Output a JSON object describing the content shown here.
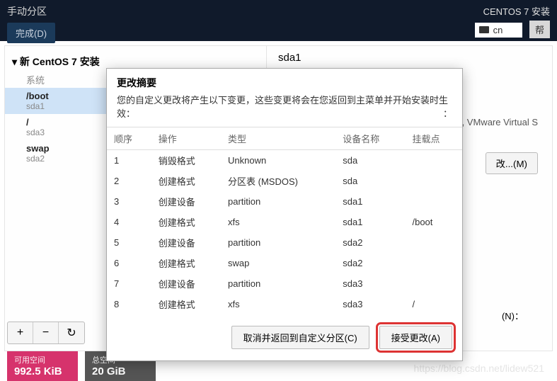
{
  "header": {
    "left_title": "手动分区",
    "done_btn": "完成(D)",
    "right_title": "CENTOS 7 安装",
    "lang": "cn",
    "help_btn": "帮"
  },
  "sidebar": {
    "expand_label": "▾ 新 CentOS 7 安装",
    "system_label": "系统",
    "partitions": [
      {
        "name": "/boot",
        "dev": "sda1",
        "selected": true
      },
      {
        "name": "/",
        "dev": "sda3",
        "selected": false
      },
      {
        "name": "swap",
        "dev": "sda2",
        "selected": false
      }
    ]
  },
  "right": {
    "title": "sda1",
    "vm_text": "are, VMware Virtual S",
    "modify_btn": "改...(M)",
    "n_label": "(N)："
  },
  "toolbar": {
    "add": "+",
    "remove": "−",
    "reload": "↻"
  },
  "footer": {
    "avail_label": "可用空间",
    "avail_value": "992.5 KiB",
    "total_label": "总空间",
    "total_value": "20 GiB"
  },
  "watermark": "https://blog.csdn.net/lidew521",
  "dialog": {
    "title": "更改摘要",
    "desc": "您的自定义更改将产生以下变更，这些变更将会在您返回到主菜单并开始安装时生效：",
    "colon": "：",
    "headers": {
      "order": "顺序",
      "operation": "操作",
      "type": "类型",
      "device": "设备名称",
      "mount": "挂载点"
    },
    "rows": [
      {
        "order": "1",
        "op": "销毁格式",
        "op_class": "destroy",
        "type": "Unknown",
        "device": "sda",
        "mount": ""
      },
      {
        "order": "2",
        "op": "创建格式",
        "op_class": "create",
        "type": "分区表 (MSDOS)",
        "device": "sda",
        "mount": ""
      },
      {
        "order": "3",
        "op": "创建设备",
        "op_class": "create",
        "type": "partition",
        "device": "sda1",
        "mount": ""
      },
      {
        "order": "4",
        "op": "创建格式",
        "op_class": "create",
        "type": "xfs",
        "device": "sda1",
        "mount": "/boot"
      },
      {
        "order": "5",
        "op": "创建设备",
        "op_class": "create",
        "type": "partition",
        "device": "sda2",
        "mount": ""
      },
      {
        "order": "6",
        "op": "创建格式",
        "op_class": "create",
        "type": "swap",
        "device": "sda2",
        "mount": ""
      },
      {
        "order": "7",
        "op": "创建设备",
        "op_class": "create",
        "type": "partition",
        "device": "sda3",
        "mount": ""
      },
      {
        "order": "8",
        "op": "创建格式",
        "op_class": "create",
        "type": "xfs",
        "device": "sda3",
        "mount": "/"
      }
    ],
    "cancel_btn": "取消并返回到自定义分区(C)",
    "accept_btn": "接受更改(A)"
  }
}
